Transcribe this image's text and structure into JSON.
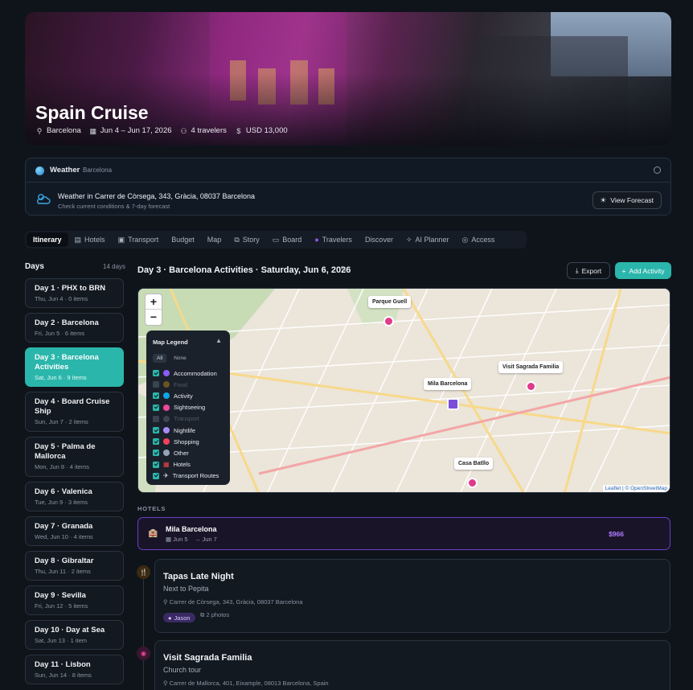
{
  "trip": {
    "title": "Spain Cruise",
    "location": "Barcelona",
    "dates": "Jun 4 – Jun 17, 2026",
    "travelers": "4 travelers",
    "budget": "USD 13,000"
  },
  "weather": {
    "title": "Weather",
    "location": "Barcelona",
    "line1": "Weather in Carrer de Còrsega, 343, Gràcia, 08037 Barcelona",
    "line2": "Check current conditions & 7-day forecast",
    "button": "View Forecast"
  },
  "tabs": [
    {
      "label": "Itinerary",
      "icon": "",
      "active": true
    },
    {
      "label": "Hotels",
      "icon": "hotel-icon"
    },
    {
      "label": "Transport",
      "icon": "transport-icon"
    },
    {
      "label": "Budget",
      "icon": ""
    },
    {
      "label": "Map",
      "icon": ""
    },
    {
      "label": "Story",
      "icon": "story-icon"
    },
    {
      "label": "Board",
      "icon": "board-icon"
    },
    {
      "label": "Travelers",
      "icon": "travelers-icon"
    },
    {
      "label": "Discover",
      "icon": ""
    },
    {
      "label": "AI Planner",
      "icon": "ai-icon"
    },
    {
      "label": "Access",
      "icon": "access-icon"
    }
  ],
  "days": {
    "heading": "Days",
    "count": "14 days",
    "items": [
      {
        "title": "Day 1 · PHX to BRN",
        "sub": "Thu, Jun 4 · 0 items"
      },
      {
        "title": "Day 2 · Barcelona",
        "sub": "Fri, Jun 5 · 6 items"
      },
      {
        "title": "Day 3 · Barcelona Activities",
        "sub": "Sat, Jun 6 · 9 items",
        "active": true
      },
      {
        "title": "Day 4 · Board Cruise Ship",
        "sub": "Sun, Jun 7 · 2 items"
      },
      {
        "title": "Day 5 · Palma de Mallorca",
        "sub": "Mon, Jun 8 · 4 items"
      },
      {
        "title": "Day 6 · Valenica",
        "sub": "Tue, Jun 9 · 3 items"
      },
      {
        "title": "Day 7 · Granada",
        "sub": "Wed, Jun 10 · 4 items"
      },
      {
        "title": "Day 8 · Gibraltar",
        "sub": "Thu, Jun 11 · 2 items"
      },
      {
        "title": "Day 9 · Sevilla",
        "sub": "Fri, Jun 12 · 5 items"
      },
      {
        "title": "Day 10 · Day at Sea",
        "sub": "Sat, Jun 13 · 1 item"
      },
      {
        "title": "Day 11 · Lisbon",
        "sub": "Sun, Jun 14 · 8 items"
      }
    ]
  },
  "main": {
    "title": "Day 3 · Barcelona Activities · Saturday, Jun 6, 2026",
    "export": "Export",
    "add": "Add Activity"
  },
  "map": {
    "zoom_in": "+",
    "zoom_out": "−",
    "legend_title": "Map Legend",
    "legend_all": "All",
    "legend_none": "None",
    "legend": [
      {
        "label": "Accommodation",
        "color": "#8b5cf6",
        "on": true
      },
      {
        "label": "Food",
        "color": "#f59e0b",
        "on": false
      },
      {
        "label": "Activity",
        "color": "#0ea5e9",
        "on": true
      },
      {
        "label": "Sightseeing",
        "color": "#ec4899",
        "on": true
      },
      {
        "label": "Transport",
        "color": "#64748b",
        "on": false
      },
      {
        "label": "Nightlife",
        "color": "#a78bfa",
        "on": true
      },
      {
        "label": "Shopping",
        "color": "#f43f5e",
        "on": true
      },
      {
        "label": "Other",
        "color": "#94a3b8",
        "on": true
      },
      {
        "label": "Hotels",
        "color": "#ef4444",
        "on": true
      },
      {
        "label": "Transport Routes",
        "color": "#e5e7eb",
        "on": true
      }
    ],
    "pins": [
      {
        "label": "Parque Guell"
      },
      {
        "label": "Visit Sagrada Familia"
      },
      {
        "label": "Mila Barcelona"
      },
      {
        "label": "Casa Batllo"
      }
    ],
    "attribution": "Leaflet | © OpenStreetMap"
  },
  "hotels": {
    "heading": "HOTELS",
    "name": "Mila Barcelona",
    "checkin": "Jun 5",
    "checkout": "→ Jun 7",
    "price": "$966"
  },
  "activities": [
    {
      "title": "Tapas Late Night",
      "sub": "Next to Pepita",
      "address": "Carrer de Còrsega, 343, Gràcia, 08037 Barcelona",
      "tag": "Jason",
      "photos": "2 photos",
      "icon": "food-icon",
      "color": "#f59e0b"
    },
    {
      "title": "Visit Sagrada Familia",
      "sub": "Church tour",
      "address": "Carrer de Mallorca, 401, Eixample, 08013 Barcelona, Spain",
      "icon": "camera-icon",
      "color": "#ec4899"
    }
  ]
}
